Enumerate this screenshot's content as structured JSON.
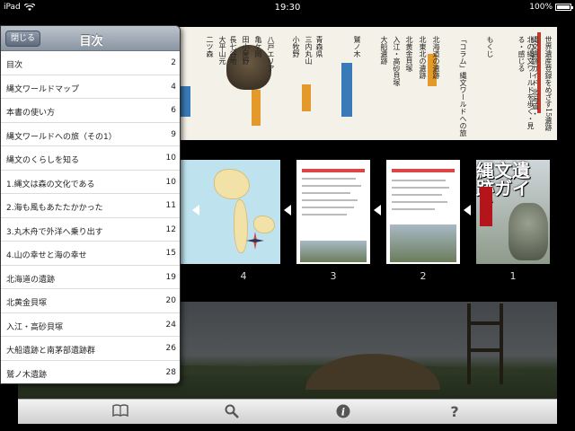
{
  "status_bar": {
    "device": "iPad",
    "time": "19:30",
    "battery": "100%",
    "battery_level": 1.0
  },
  "popover": {
    "title": "目次",
    "close_label": "閉じる",
    "items": [
      {
        "label": "目次",
        "page": "2"
      },
      {
        "label": "縄文ワールドマップ",
        "page": "4"
      },
      {
        "label": "本書の使い方",
        "page": "6"
      },
      {
        "label": "縄文ワールドへの旅（その1）",
        "page": "9"
      },
      {
        "label": "縄文のくらしを知る",
        "page": "10"
      },
      {
        "label": "1.縄文は森の文化である",
        "page": "10"
      },
      {
        "label": "2.海も風もあたたかかった",
        "page": "11"
      },
      {
        "label": "3.丸木舟で外洋へ乗り出す",
        "page": "12"
      },
      {
        "label": "4.山の幸せと海の幸せ",
        "page": "15"
      },
      {
        "label": "北海道の遺跡",
        "page": "19"
      },
      {
        "label": "北黄金貝塚",
        "page": "20"
      },
      {
        "label": "入江・高砂貝塚",
        "page": "24"
      },
      {
        "label": "大船遺跡と南茅部遺跡群",
        "page": "26"
      },
      {
        "label": "鷲ノ木遺跡",
        "page": "28"
      }
    ]
  },
  "page_spread": {
    "vertical_texts": [
      "世界遺産登録をめざす15遺跡",
      "縄文遺跡ガイド 北海道・",
      "北の縄文ワールドを歩く・見る・感じる",
      "もくじ",
      "「コラム」縄文ワールドへの旅",
      "北海道の遺跡",
      "北東北の遺跡",
      "北黄金貝塚",
      "入江・高砂貝塚",
      "大船遺跡",
      "鷲ノ木",
      "青森県",
      "三内丸山",
      "小牧野",
      "八戸エリア",
      "亀ケ岡",
      "田小屋野",
      "長七谷地",
      "大平山元",
      "二ツ森"
    ]
  },
  "thumbnails": [
    {
      "number": "4",
      "kind": "map"
    },
    {
      "number": "3",
      "kind": "toc"
    },
    {
      "number": "2",
      "kind": "toc"
    },
    {
      "number": "1",
      "kind": "cover",
      "cover_title": "縄文遺跡ガイド"
    }
  ],
  "toolbar": {
    "items": [
      {
        "name": "bookmarks-icon",
        "glyph": "📖"
      },
      {
        "name": "search-icon",
        "glyph": "🔍"
      },
      {
        "name": "info-icon",
        "glyph": "i"
      },
      {
        "name": "help-icon",
        "glyph": "?"
      }
    ]
  }
}
